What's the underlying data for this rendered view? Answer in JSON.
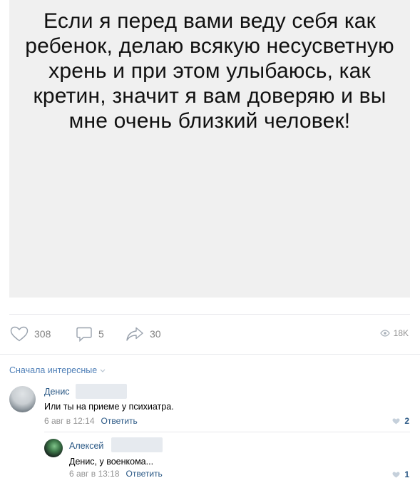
{
  "post": {
    "image_text": "Если я перед вами веду себя как ребенок, делаю всякую несусветную хрень и при этом улыбаюсь, как кретин, значит я вам доверяю и вы мне очень близкий человек!"
  },
  "actions": {
    "likes": "308",
    "comments": "5",
    "shares": "30",
    "views": "18K"
  },
  "comments_sort": "Сначала интересные",
  "comments": [
    {
      "author": "Денис",
      "text": "Или ты на приеме у психиатра.",
      "date": "6 авг в 12:14",
      "reply_label": "Ответить",
      "likes": "2"
    },
    {
      "author": "Алексей",
      "text": "Денис, у военкома...",
      "date": "6 авг в 13:18",
      "reply_label": "Ответить",
      "likes": "1"
    }
  ],
  "colors": {
    "link": "#2a5885",
    "accent": "#5181b8",
    "muted": "#939393",
    "image_bg": "#f0f0f0"
  },
  "icons": [
    "heart-icon",
    "comment-icon",
    "share-icon",
    "eye-icon",
    "chevron-down-icon"
  ]
}
